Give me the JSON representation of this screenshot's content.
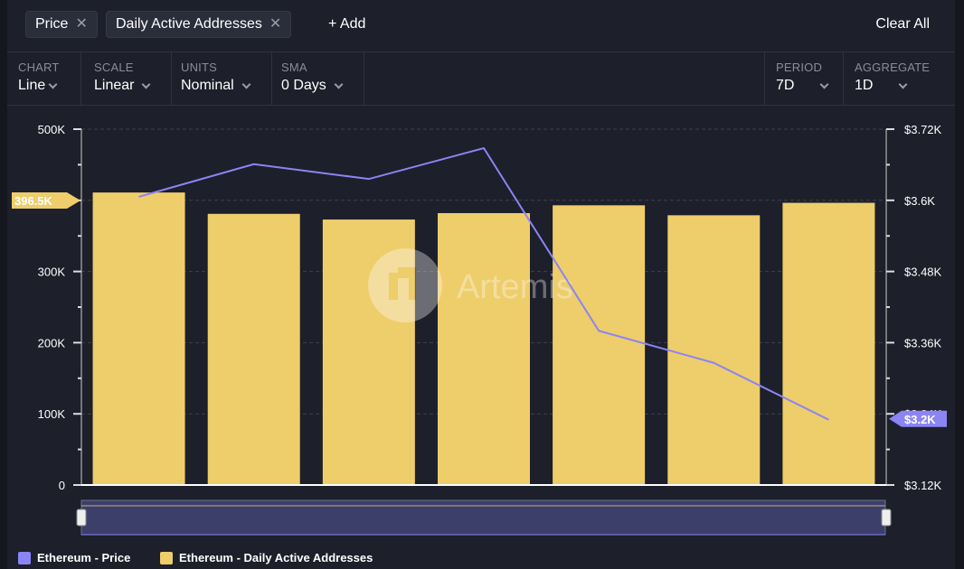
{
  "metrics": [
    {
      "label": "Price",
      "remove": "✕"
    },
    {
      "label": "Daily Active Addresses",
      "remove": "✕"
    }
  ],
  "add_label": "+ Add",
  "clear_label": "Clear All",
  "controls": [
    {
      "label": "CHART",
      "value": "Line"
    },
    {
      "label": "SCALE",
      "value": "Linear"
    },
    {
      "label": "UNITS",
      "value": "Nominal"
    },
    {
      "label": "SMA",
      "value": "0 Days"
    },
    {
      "label": "PERIOD",
      "value": "7D"
    },
    {
      "label": "AGGREGATE",
      "value": "1D"
    }
  ],
  "watermark": "Artemis",
  "colors": {
    "price": "#8b84f5",
    "daa": "#eecd6b",
    "background": "#1d1f2a"
  },
  "chart_data": {
    "type": "bar+line",
    "left_axis": {
      "ticks": [
        "0",
        "100K",
        "200K",
        "300K",
        "400K",
        "500K"
      ],
      "ylim": [
        0,
        500000
      ],
      "current_label": "396.5K"
    },
    "right_axis": {
      "ticks": [
        "$3.12K",
        "$3.24K",
        "$3.36K",
        "$3.48K",
        "$3.6K",
        "$3.72K"
      ],
      "ylim": [
        3120,
        3720
      ],
      "current_label": "$3.2K"
    },
    "grid": true,
    "series": [
      {
        "name": "Ethereum - Daily Active Addresses",
        "type": "bar",
        "axis": "left",
        "values": [
          411000,
          381000,
          373000,
          382000,
          393000,
          379000,
          396500
        ]
      },
      {
        "name": "Ethereum - Price",
        "type": "line",
        "axis": "right",
        "values": [
          3606,
          3661,
          3636,
          3688,
          3380,
          3326,
          3230
        ]
      }
    ],
    "legend": "bottom-left"
  }
}
